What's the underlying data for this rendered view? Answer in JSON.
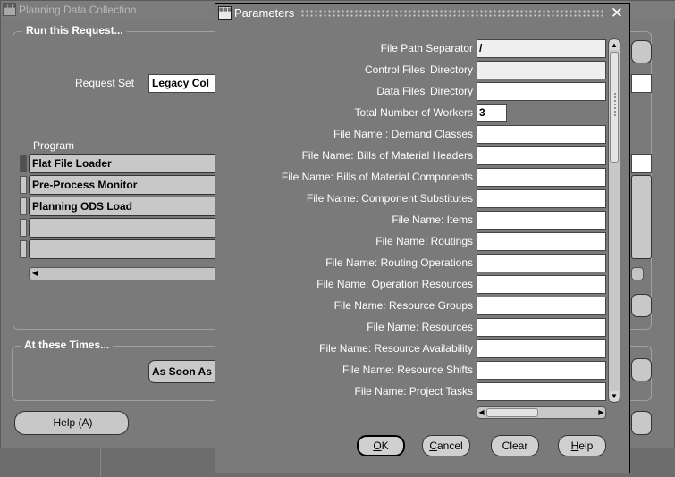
{
  "background_window": {
    "title": "Planning Data Collection",
    "run_group_title": "Run this Request...",
    "request_set_label": "Request Set",
    "request_set_value": "Legacy Col",
    "program_column_label": "Program",
    "programs": [
      "Flat File Loader",
      "Pre-Process Monitor",
      "Planning ODS Load",
      "",
      ""
    ],
    "times_group_title": "At these Times...",
    "schedule_value": "As Soon As",
    "help_button": "Help (A)"
  },
  "dialog": {
    "title": "Parameters",
    "close_glyph": "✕",
    "parameters": [
      {
        "label": "File Path Separator",
        "value": "/",
        "greyed": true
      },
      {
        "label": "Control Files' Directory",
        "value": "",
        "greyed": true
      },
      {
        "label": "Data Files' Directory",
        "value": "",
        "greyed": false
      },
      {
        "label": "Total Number of Workers",
        "value": "3",
        "greyed": false
      },
      {
        "label": "File Name : Demand Classes",
        "value": "",
        "greyed": false
      },
      {
        "label": "File Name: Bills of Material Headers",
        "value": "",
        "greyed": false
      },
      {
        "label": "File Name: Bills of Material Components",
        "value": "",
        "greyed": false
      },
      {
        "label": "File Name: Component Substitutes",
        "value": "",
        "greyed": false
      },
      {
        "label": "File Name: Items",
        "value": "",
        "greyed": false
      },
      {
        "label": "File Name: Routings",
        "value": "",
        "greyed": false
      },
      {
        "label": "File Name: Routing Operations",
        "value": "",
        "greyed": false
      },
      {
        "label": "File Name: Operation Resources",
        "value": "",
        "greyed": false
      },
      {
        "label": "File Name:  Resource Groups",
        "value": "",
        "greyed": false
      },
      {
        "label": "File Name: Resources",
        "value": "",
        "greyed": false
      },
      {
        "label": "File Name: Resource Availability",
        "value": "",
        "greyed": false
      },
      {
        "label": "File Name: Resource Shifts",
        "value": "",
        "greyed": false
      },
      {
        "label": "File Name: Project Tasks",
        "value": "",
        "greyed": false
      }
    ],
    "buttons": {
      "ok": {
        "mnemonic": "O",
        "rest": "K"
      },
      "cancel": {
        "mnemonic": "C",
        "rest": "ancel"
      },
      "clear": {
        "mnemonic": "",
        "rest": "Clear"
      },
      "help": {
        "mnemonic": "H",
        "rest": "elp"
      }
    }
  },
  "colors": {
    "background": "#7a7a7a",
    "field_white": "#ffffff",
    "button_grey": "#c8c8c8",
    "label_text": "#ffffff"
  }
}
